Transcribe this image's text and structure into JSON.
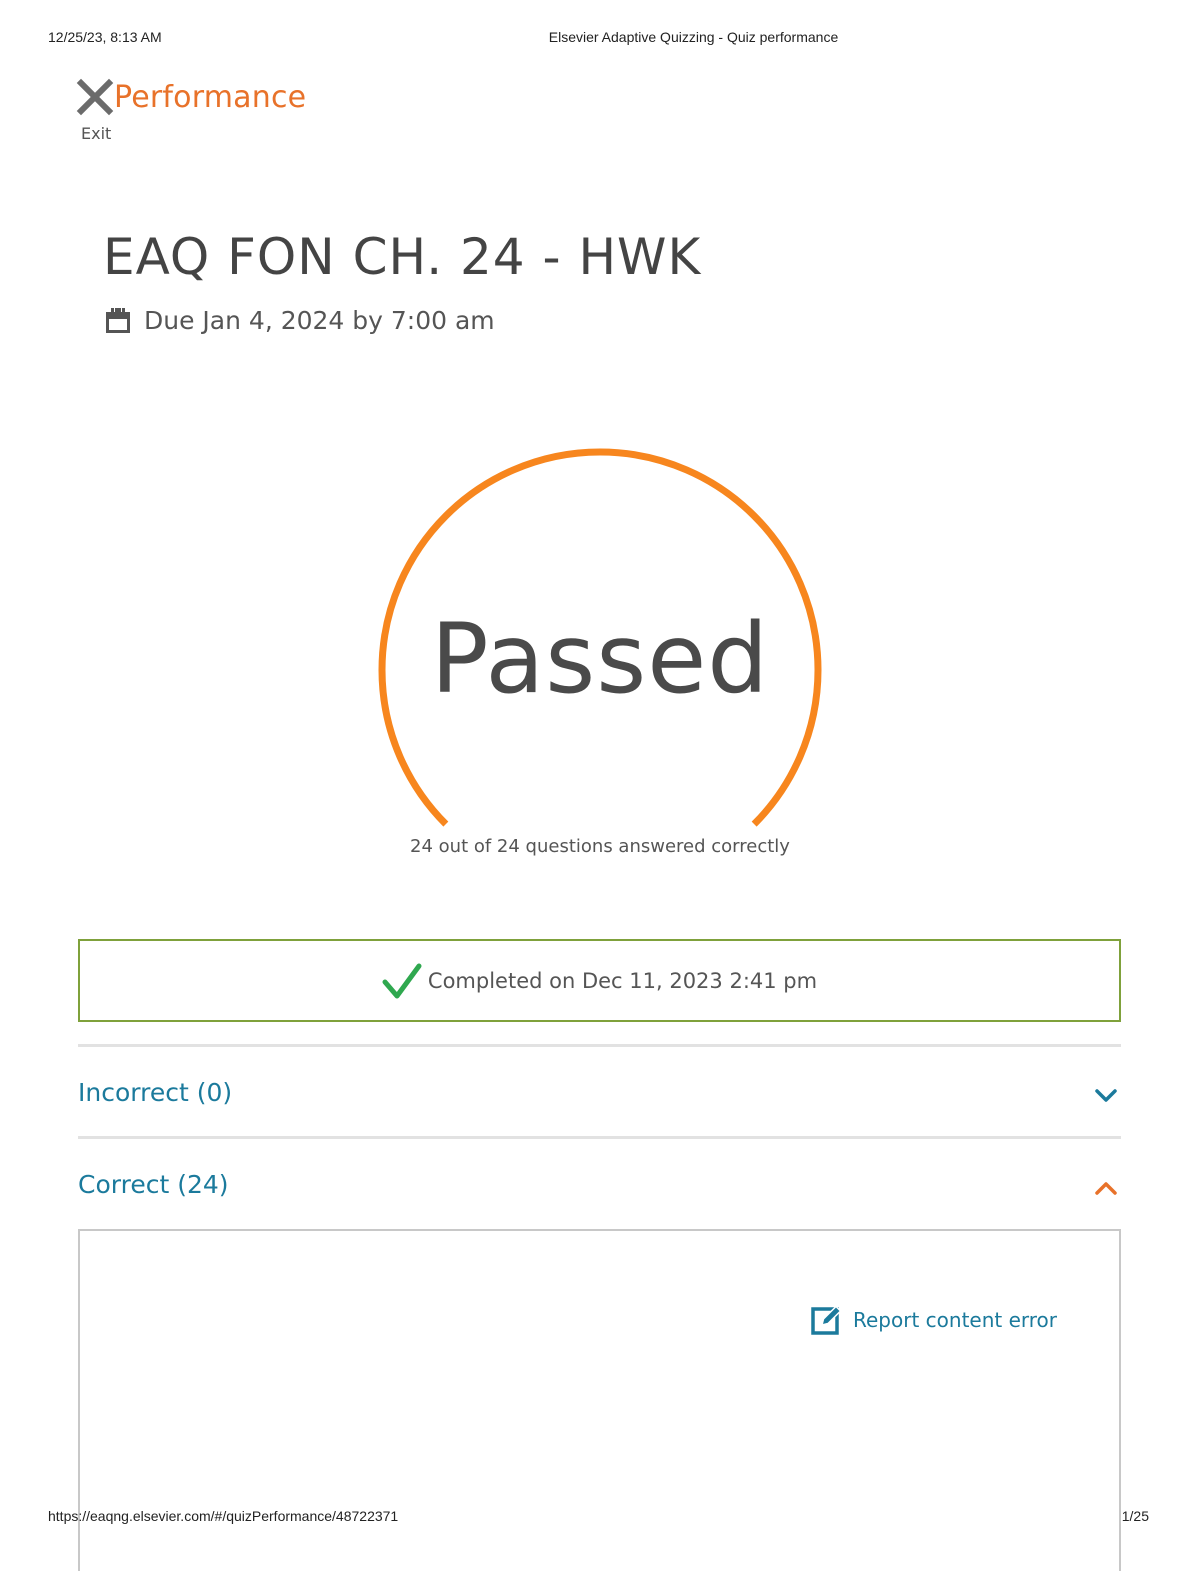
{
  "print_header": {
    "datetime": "12/25/23, 8:13 AM",
    "page_title": "Elsevier Adaptive Quizzing - Quiz performance"
  },
  "print_footer": {
    "url": "https://eaqng.elsevier.com/#/quizPerformance/48722371",
    "page_indicator": "1/25"
  },
  "nav": {
    "exit_label": "Exit",
    "section_title": "Performance"
  },
  "quiz": {
    "title": "EAQ FON CH. 24 - HWK",
    "due": "Due Jan 4, 2024 by 7:00 am"
  },
  "result": {
    "status": "Passed",
    "score_text": "24 out of 24 questions answered correctly",
    "correct": 24,
    "total": 24
  },
  "completion": {
    "text": "Completed on Dec 11, 2023 2:41 pm"
  },
  "sections": {
    "incorrect_label": "Incorrect (0)",
    "correct_label": "Correct (24)"
  },
  "panel": {
    "report_label": "Report content error"
  },
  "colors": {
    "accent_orange": "#f7861e",
    "title_orange": "#e8722a",
    "link_blue": "#1b7a9c",
    "success_green": "#2fa84f",
    "box_border_green": "#7fa13b"
  },
  "icons": {
    "exit": "close-icon",
    "due": "calendar-icon",
    "completed": "checkmark-icon",
    "incorrect_toggle": "chevron-down-icon",
    "correct_toggle": "chevron-up-icon",
    "report": "edit-icon"
  }
}
